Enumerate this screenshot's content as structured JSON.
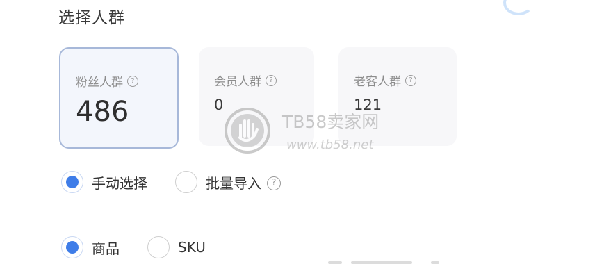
{
  "section": {
    "title": "选择人群"
  },
  "cards": [
    {
      "label": "粉丝人群",
      "value": "486",
      "help_icon": "question-circle-icon",
      "selected": true
    },
    {
      "label": "会员人群",
      "value": "0",
      "help_icon": "question-circle-icon",
      "selected": false
    },
    {
      "label": "老客人群",
      "value": "121",
      "help_icon": "question-circle-icon",
      "selected": false
    }
  ],
  "selection_mode": {
    "options": [
      {
        "label": "手动选择",
        "checked": true
      },
      {
        "label": "批量导入",
        "checked": false
      }
    ],
    "help_icon": "question-circle-icon"
  },
  "item_type": {
    "options": [
      {
        "label": "商品",
        "checked": true
      },
      {
        "label": "SKU",
        "checked": false
      }
    ]
  },
  "watermark": {
    "title": "TB58卖家网",
    "url": "www.tb58.net",
    "logo_icon": "hand-logo-icon"
  },
  "colors": {
    "accent": "#3f7de8",
    "selected_border": "#a7b8d9",
    "card_bg": "#f7f7f9",
    "text": "#333333"
  }
}
